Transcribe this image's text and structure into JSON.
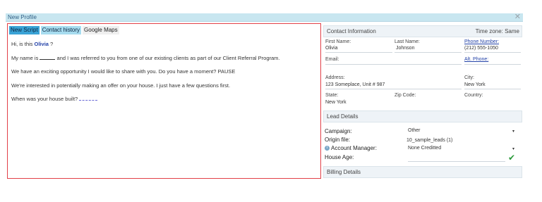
{
  "window": {
    "title": "New Profile",
    "close_symbol": "✕"
  },
  "script_panel": {
    "tabs": [
      {
        "label": "New Script"
      },
      {
        "label": "Contact history"
      },
      {
        "label": "Google Maps"
      }
    ],
    "lines": {
      "greeting_prefix": "Hi, is this ",
      "greeting_name": "Olivia",
      "greeting_suffix": " ?",
      "referral_prefix": "My name is ",
      "referral_suffix": " and I was referred to you from one of our existing clients as part of our Client Referral Program.",
      "opportunity": "We have an exciting opportunity I would like to share with you. Do you have a moment? PAUSE",
      "interest": "We're interested in potentially making an offer on your house. I just have a few questions first.",
      "question": "When was your house built?"
    }
  },
  "contact_info": {
    "header": "Contact Information",
    "timezone": "Time zone: Same",
    "first_name_label": "First Name:",
    "first_name": "Olivia",
    "last_name_label": "Last Name:",
    "last_name": "Johnson",
    "phone_label": "Phone Number:",
    "phone": "(212) 555-1050",
    "email_label": "Email:",
    "alt_phone_label": "Alt. Phone:",
    "address_label": "Address:",
    "address": "123 Someplace, Unit # 987",
    "city_label": "City:",
    "city": "New York",
    "state_label": "State:",
    "state": "New York",
    "zip_label": "Zip Code:",
    "country_label": "Country:"
  },
  "lead_details": {
    "header": "Lead Details",
    "campaign_label": "Campaign:",
    "campaign": "Other",
    "origin_label": "Origin file:",
    "origin": "10_sample_leads (1)",
    "manager_label": "Account Manager:",
    "manager": "None Creditted",
    "house_age_label": "House Age:",
    "info_icon": "i",
    "dropdown_arrow": "▾",
    "check_symbol": "✔"
  },
  "billing_details": {
    "header": "Billing Details"
  }
}
